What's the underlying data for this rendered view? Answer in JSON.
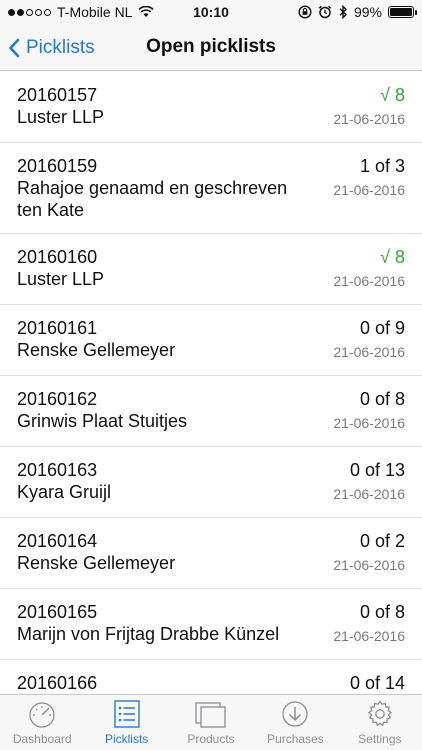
{
  "status": {
    "carrier": "T-Mobile NL",
    "time": "10:10",
    "battery": "99%",
    "battery_level": 0.99,
    "signal_filled": 2,
    "signal_total": 5
  },
  "nav": {
    "back_label": "Picklists",
    "title": "Open picklists"
  },
  "picklists": [
    {
      "id": "20160157",
      "name": "Luster LLP",
      "count": "√ 8",
      "done": true,
      "date": "21-06-2016"
    },
    {
      "id": "20160159",
      "name": "Rahajoe genaamd en geschreven ten Kate",
      "count": "1 of 3",
      "done": false,
      "date": "21-06-2016"
    },
    {
      "id": "20160160",
      "name": "Luster LLP",
      "count": "√ 8",
      "done": true,
      "date": "21-06-2016"
    },
    {
      "id": "20160161",
      "name": "Renske Gellemeyer",
      "count": "0 of 9",
      "done": false,
      "date": "21-06-2016"
    },
    {
      "id": "20160162",
      "name": "Grinwis Plaat Stuitjes",
      "count": "0 of 8",
      "done": false,
      "date": "21-06-2016"
    },
    {
      "id": "20160163",
      "name": "Kyara Gruijl",
      "count": "0 of 13",
      "done": false,
      "date": "21-06-2016"
    },
    {
      "id": "20160164",
      "name": "Renske Gellemeyer",
      "count": "0 of 2",
      "done": false,
      "date": "21-06-2016"
    },
    {
      "id": "20160165",
      "name": "Marijn von Frijtag Drabbe Künzel",
      "count": "0 of 8",
      "done": false,
      "date": "21-06-2016"
    },
    {
      "id": "20160166",
      "name": "",
      "count": "0 of 14",
      "done": false,
      "date": ""
    }
  ],
  "tabs": [
    {
      "label": "Dashboard",
      "icon": "gauge-icon",
      "active": false
    },
    {
      "label": "Picklists",
      "icon": "list-icon",
      "active": true
    },
    {
      "label": "Products",
      "icon": "products-icon",
      "active": false
    },
    {
      "label": "Purchases",
      "icon": "download-circle-icon",
      "active": false
    },
    {
      "label": "Settings",
      "icon": "gear-icon",
      "active": false
    }
  ],
  "colors": {
    "accent": "#1f7ad2",
    "done": "#2fa82f",
    "muted": "#8e8e93"
  }
}
